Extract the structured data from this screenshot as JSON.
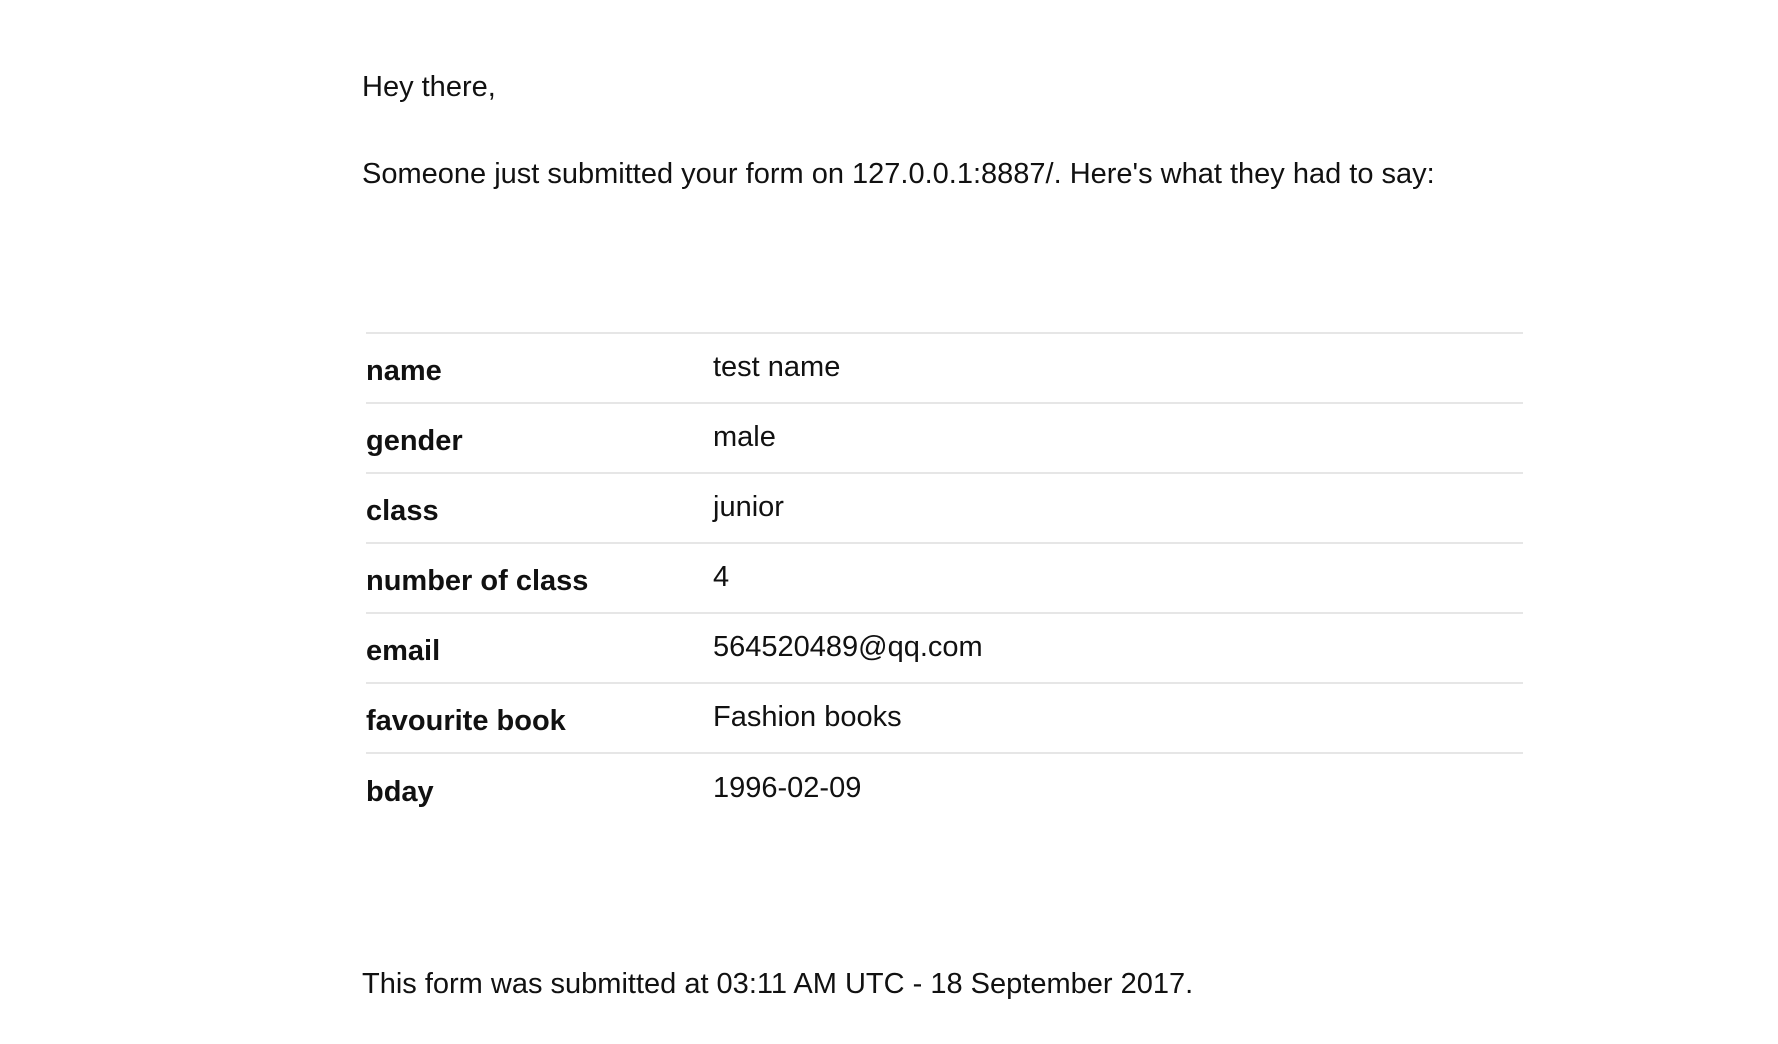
{
  "greeting": "Hey there,",
  "intro": "Someone just submitted your form on 127.0.0.1:8887/. Here's what they had to say:",
  "fields": [
    {
      "label": "name",
      "value": "test name"
    },
    {
      "label": "gender",
      "value": "male"
    },
    {
      "label": "class",
      "value": "junior"
    },
    {
      "label": "number of class",
      "value": "4"
    },
    {
      "label": "email",
      "value": "564520489@qq.com"
    },
    {
      "label": "favourite book",
      "value": "Fashion books"
    },
    {
      "label": "bday",
      "value": "1996-02-09"
    }
  ],
  "footer": "This form was submitted at 03:11 AM UTC - 18 September 2017."
}
